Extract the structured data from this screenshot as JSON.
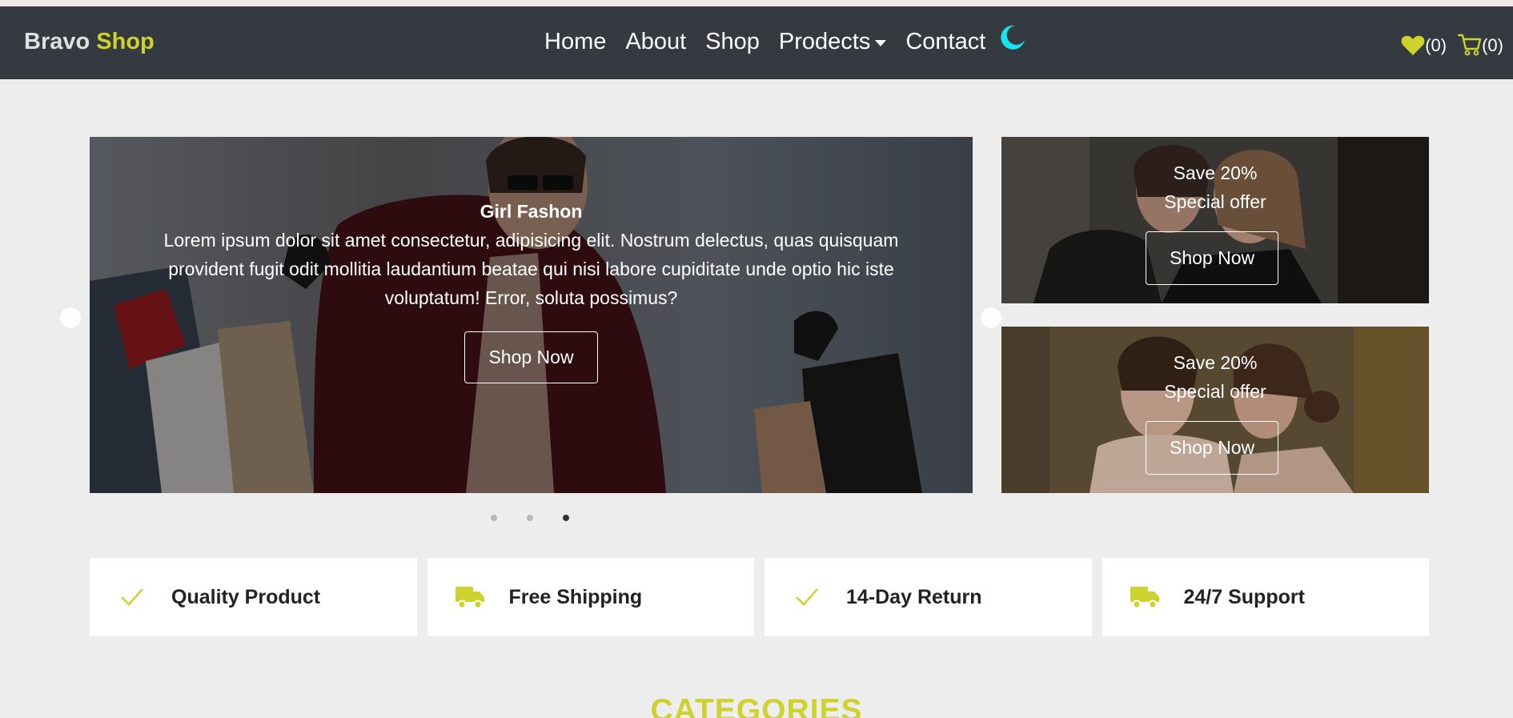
{
  "brand": {
    "name": "Bravo",
    "accent": "Shop"
  },
  "nav": {
    "links": [
      {
        "label": "Home"
      },
      {
        "label": "About"
      },
      {
        "label": "Shop"
      },
      {
        "label": "Prodects"
      },
      {
        "label": "Contact"
      }
    ],
    "theme_icon": "moon-icon",
    "wishlist_count": "(0)",
    "cart_count": "(0)"
  },
  "hero": {
    "title": "Girl Fashon",
    "text": "Lorem ipsum dolor sit amet consectetur, adipisicing elit. Nostrum delectus, quas quisquam provident fugit odit mollitia laudantium beatae qui nisi labore cupiditate unde optio hic iste voluptatum! Error, soluta possimus?",
    "button": "Shop Now",
    "slide_count": 3,
    "active_slide": 3
  },
  "promos": [
    {
      "line1": "Save 20%",
      "line2": "Special offer",
      "button": "Shop Now"
    },
    {
      "line1": "Save 20%",
      "line2": "Special offer",
      "button": "Shop Now"
    }
  ],
  "features": [
    {
      "label": "Quality Product",
      "icon": "check-icon"
    },
    {
      "label": "Free Shipping",
      "icon": "truck-icon"
    },
    {
      "label": "14-Day Return",
      "icon": "check-icon"
    },
    {
      "label": "24/7 Support",
      "icon": "truck-icon"
    }
  ],
  "section_title": "CATEGORIES",
  "colors": {
    "accent": "#cdd22c",
    "navbar": "#353a40",
    "background": "#ededed",
    "moon": "#19e3f0"
  }
}
